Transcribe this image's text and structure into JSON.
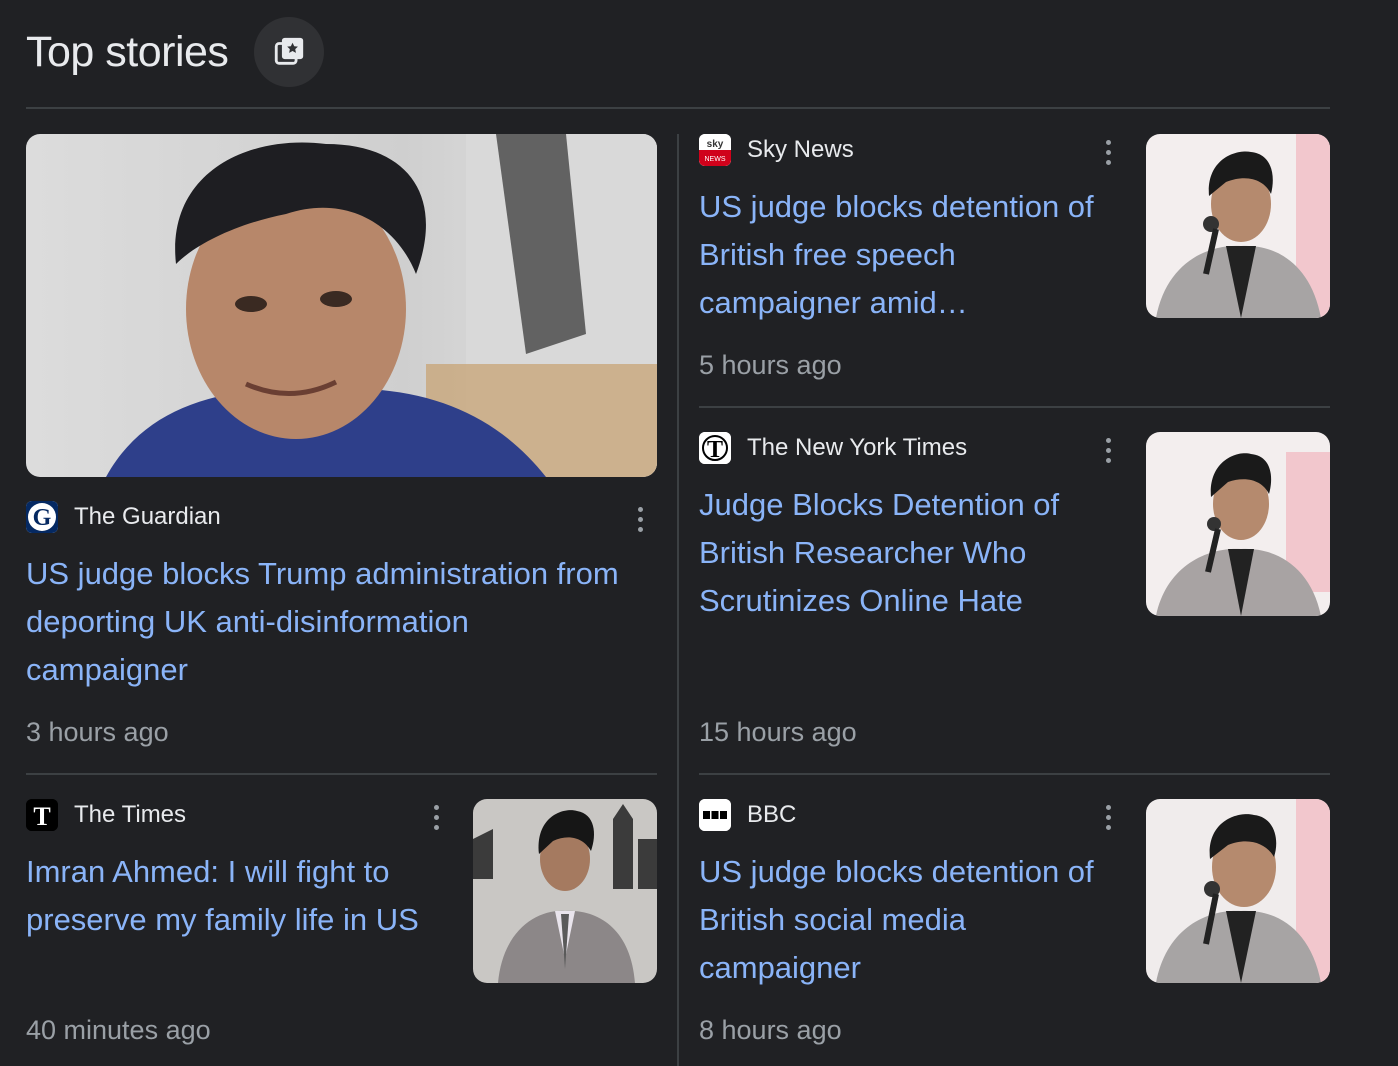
{
  "section": {
    "title": "Top stories",
    "header_icon": "view-more-stories-icon"
  },
  "stories": [
    {
      "source": "The Guardian",
      "favicon": "guardian-logo-icon",
      "headline_lines": [
        "US judge blocks Trump administration from",
        "deporting UK anti-disinformation",
        "campaigner"
      ],
      "time": "3 hours ago"
    },
    {
      "source": "Sky News",
      "favicon": "sky-news-logo-icon",
      "headline_lines": [
        "US judge blocks detention of",
        "British free speech",
        "campaigner amid…"
      ],
      "time": "5 hours ago"
    },
    {
      "source": "The New York Times",
      "favicon": "nyt-logo-icon",
      "headline_lines": [
        "Judge Blocks Detention of",
        "British Researcher Who",
        "Scrutinizes Online Hate"
      ],
      "time": "15 hours ago"
    },
    {
      "source": "The Times",
      "favicon": "the-times-logo-icon",
      "headline_lines": [
        "Imran Ahmed: I will fight to",
        "preserve my family life in US"
      ],
      "time": "40 minutes ago"
    },
    {
      "source": "BBC",
      "favicon": "bbc-logo-icon",
      "headline_lines": [
        "US judge blocks detention of",
        "British social media",
        "campaigner"
      ],
      "time": "8 hours ago"
    }
  ],
  "colors": {
    "background": "#202124",
    "link": "#8ab4f8",
    "meta": "#9aa0a6",
    "divider": "#3c4043"
  }
}
